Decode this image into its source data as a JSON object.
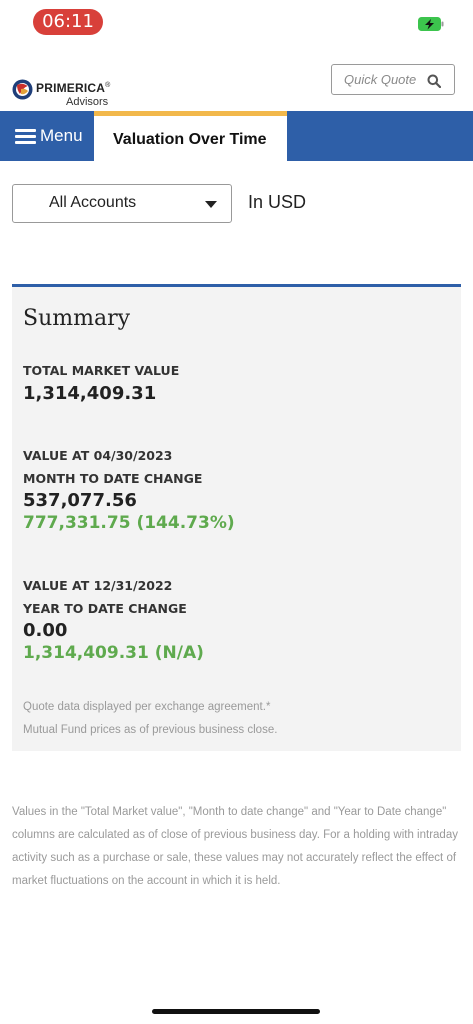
{
  "status_bar": {
    "time": "06:11",
    "battery_color": "#3cc44d"
  },
  "header": {
    "brand": "PRIMERICA",
    "brand_suffix": "®",
    "brand_sub": "Advisors",
    "quick_quote_placeholder": "Quick Quote",
    "search_icon": "search-icon"
  },
  "nav": {
    "menu_label": "Menu",
    "active_tab": "Valuation Over Time",
    "bar_color": "#2e5fa8",
    "tab_accent": "#f2b84b"
  },
  "filters": {
    "account_selected": "All Accounts",
    "currency": "In USD"
  },
  "summary": {
    "title": "Summary",
    "total_market_value_label": "TOTAL MARKET VALUE",
    "total_market_value": "1,314,409.31",
    "mtd_value_at_label": "VALUE AT 04/30/2023",
    "mtd_change_label": "MONTH TO DATE CHANGE",
    "mtd_value": "537,077.56",
    "mtd_change": "777,331.75 (144.73%)",
    "ytd_value_at_label": "VALUE AT 12/31/2022",
    "ytd_change_label": "YEAR TO DATE CHANGE",
    "ytd_value": "0.00",
    "ytd_change": "1,314,409.31 (N/A)",
    "note_1": "Quote data displayed per exchange agreement.*",
    "note_2": "Mutual Fund prices as of previous business close.",
    "positive_color": "#5faa4e"
  },
  "disclaimer": "Values in the \"Total Market value\", \"Month to date change\" and \"Year to Date change\" columns are calculated as of close of previous business day. For a holding with intraday activity such as a purchase or sale, these values may not accurately reflect the effect of market fluctuations on the account in which it is held."
}
